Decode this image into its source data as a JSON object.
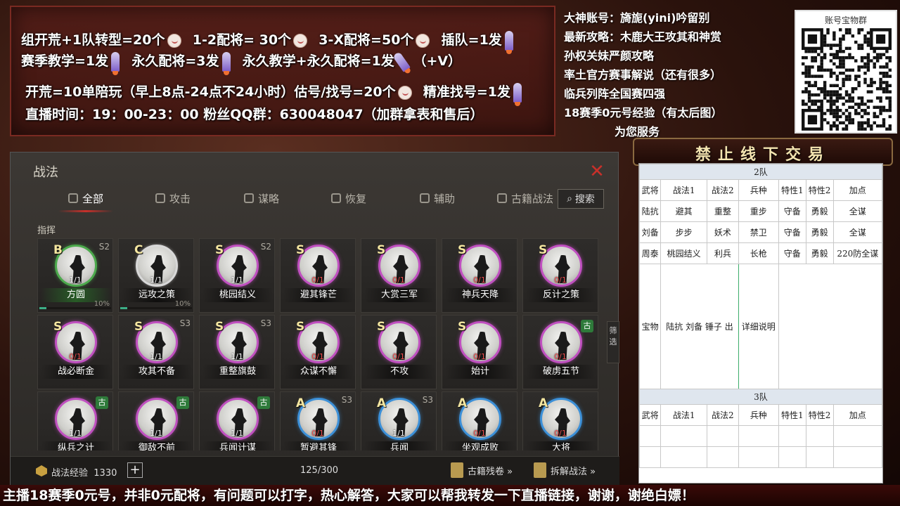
{
  "promo": {
    "line1": {
      "a": "组开荒+1队转型=20个",
      "b": "1-2配将= 30个",
      "c": "3-X配将=50个",
      "d": "插队=1发"
    },
    "line2": {
      "a": "赛季教学=1发",
      "b": "永久配将=3发",
      "c": "永久教学+永久配将=1发",
      "d": "（+V）"
    },
    "line3": {
      "a": "开荒=10单陪玩（早上8点-24点不24小时）估号/找号=20个",
      "b": "精准找号=1发"
    },
    "line4": "直播时间：19：00-23：00   粉丝QQ群：630048047（加群拿表和售后）"
  },
  "info": {
    "lines": [
      "大神账号：旖旎(yini)吟留别",
      "最新攻略：木鹿大王攻其和神赏",
      "孙权关妹严颜攻略",
      "率土官方赛事解说（还有很多）",
      "临兵列阵全国赛四强",
      "18赛季0元号经验（有太后图）",
      "为您服务"
    ]
  },
  "qr": {
    "label": "账号宝物群"
  },
  "banner": "禁止线下交易",
  "panel": {
    "title": "战法",
    "close": "✕",
    "tabs": [
      "全部",
      "攻击",
      "谋略",
      "恢复",
      "辅助",
      "古籍战法"
    ],
    "search": "搜索",
    "section": "指挥",
    "filter": "筛选",
    "skills": [
      {
        "grade": "B",
        "season": "S2",
        "name": "方圆",
        "level": "1/1",
        "ring": "g",
        "progress": 0.1,
        "pct": "10%"
      },
      {
        "grade": "C",
        "season": "",
        "name": "远攻之策",
        "level": "1/1",
        "ring": "w",
        "progress": 0.1,
        "pct": "10%"
      },
      {
        "grade": "S",
        "season": "S2",
        "name": "桃园结义",
        "level": "1/1",
        "ring": "p"
      },
      {
        "grade": "S",
        "season": "",
        "name": "避其锋芒",
        "level": "0/1",
        "ring": "p"
      },
      {
        "grade": "S",
        "season": "",
        "name": "大赏三军",
        "level": "0/1",
        "ring": "p"
      },
      {
        "grade": "S",
        "season": "",
        "name": "神兵天降",
        "level": "0/1",
        "ring": "p"
      },
      {
        "grade": "S",
        "season": "",
        "name": "反计之策",
        "level": "0/1",
        "ring": "p"
      },
      {
        "grade": "S",
        "season": "",
        "name": "战必断金",
        "level": "0/1",
        "ring": "p"
      },
      {
        "grade": "S",
        "season": "S3",
        "name": "攻其不备",
        "level": "1/1",
        "ring": "p"
      },
      {
        "grade": "S",
        "season": "S3",
        "name": "重整旗鼓",
        "level": "1/1",
        "ring": "p"
      },
      {
        "grade": "S",
        "season": "",
        "name": "众谋不懈",
        "level": "0/1",
        "ring": "p"
      },
      {
        "grade": "S",
        "season": "",
        "name": "不攻",
        "level": "0/1",
        "ring": "p"
      },
      {
        "grade": "S",
        "season": "",
        "name": "始计",
        "level": "0/1",
        "ring": "p"
      },
      {
        "grade": "",
        "season": "古",
        "name": "破虏五节",
        "level": "0/1",
        "ring": "p"
      },
      {
        "grade": "",
        "season": "古",
        "name": "纵兵之计",
        "level": "1/1",
        "ring": "p"
      },
      {
        "grade": "",
        "season": "古",
        "name": "御敌不前",
        "level": "1/1",
        "ring": "p"
      },
      {
        "grade": "",
        "season": "古",
        "name": "兵闻计谋",
        "level": "1/1",
        "ring": "p"
      },
      {
        "grade": "A",
        "season": "S3",
        "name": "暂避其锋",
        "level": "0/1",
        "ring": "b"
      },
      {
        "grade": "A",
        "season": "S3",
        "name": "兵闻",
        "level": "1/1",
        "ring": "b"
      },
      {
        "grade": "A",
        "season": "",
        "name": "坐观成败",
        "level": "0/1",
        "ring": "b"
      },
      {
        "grade": "A",
        "season": "",
        "name": "大将",
        "level": "0/1",
        "ring": "b"
      }
    ],
    "footer": {
      "exp_label": "战法经验",
      "exp_value": "1330",
      "plus": "+",
      "count": "125/300",
      "link1": "古籍残卷 »",
      "link2": "拆解战法 »"
    }
  },
  "sheet": {
    "team2": "2队",
    "headers": [
      "武将",
      "战法1",
      "战法2",
      "兵种",
      "特性1",
      "特性2",
      "加点"
    ],
    "rows": [
      [
        "陆抗",
        "避其",
        "重整",
        "重步",
        "守备",
        "勇毅",
        "全谋"
      ],
      [
        "刘备",
        "步步",
        "妖术",
        "禁卫",
        "守备",
        "勇毅",
        "全谋"
      ],
      [
        "周泰",
        "桃园结义",
        "利兵",
        "长枪",
        "守备",
        "勇毅",
        "220防全谋"
      ]
    ],
    "treasure": "宝物",
    "treasure_desc": "陆抗 刘备 锤子 出",
    "detail": "详细说明",
    "team3": "3队"
  },
  "ticker": "主播18赛季0元号，并非0元配将，有问题可以打字，热心解答，大家可以帮我转发一下直播链接，谢谢，谢绝白嫖！"
}
